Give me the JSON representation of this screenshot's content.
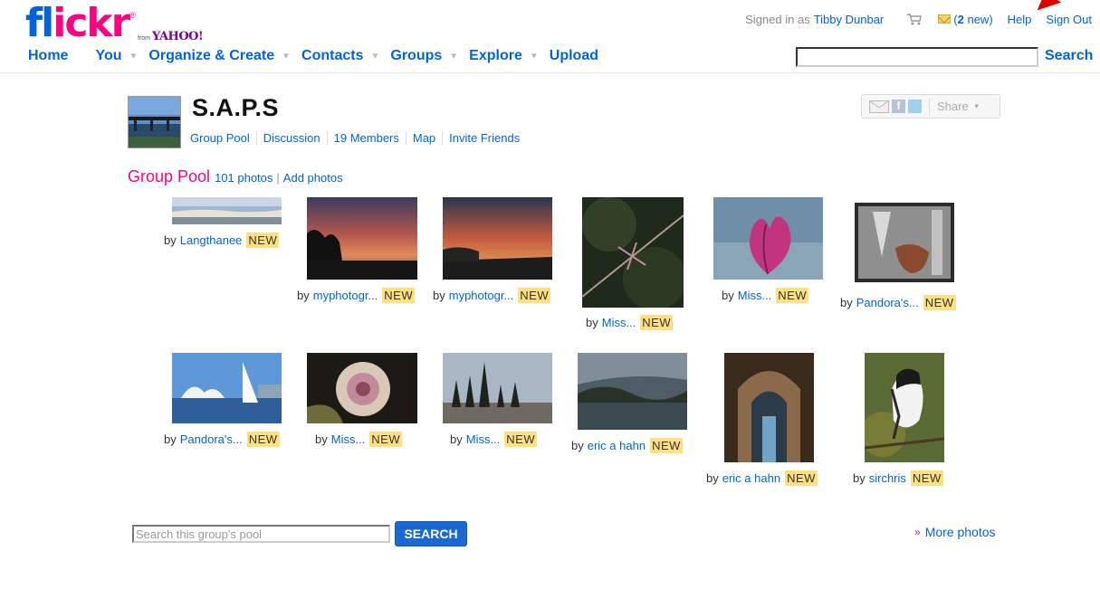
{
  "header": {
    "logo": {
      "flickr": "flickr",
      "from": "from",
      "yahoo": "YAHOO!",
      "registered": "®"
    },
    "signed_in_prefix": "Signed in as",
    "user_name": "Tibby Dunbar",
    "mail_new_count": "2",
    "mail_new_suffix": "new)",
    "mail_open_paren": "(",
    "help": "Help",
    "sign_out": "Sign Out",
    "nav": [
      "Home",
      "You",
      "Organize & Create",
      "Contacts",
      "Groups",
      "Explore",
      "Upload"
    ],
    "search_button": "Search",
    "search_value": ""
  },
  "group": {
    "title": "S.A.P.S",
    "links": [
      "Group Pool",
      "Discussion",
      "19 Members",
      "Map",
      "Invite Friends"
    ],
    "share_label": "Share"
  },
  "pool": {
    "title": "Group Pool",
    "photo_count": "101 photos",
    "separator": "|",
    "add_photos": "Add photos",
    "by_label": "by",
    "new_badge": "NEW",
    "photos": [
      {
        "author": "Langthanee"
      },
      {
        "author": "myphotogr..."
      },
      {
        "author": "myphotogr..."
      },
      {
        "author": "Miss..."
      },
      {
        "author": "Miss..."
      },
      {
        "author": "Pandora's..."
      },
      {
        "author": "Pandora's..."
      },
      {
        "author": "Miss..."
      },
      {
        "author": "Miss..."
      },
      {
        "author": "eric a hahn"
      },
      {
        "author": "eric a hahn"
      },
      {
        "author": "sirchris"
      }
    ],
    "search_placeholder": "Search this group's pool",
    "search_button": "SEARCH",
    "more_arrows": "»",
    "more_photos": "More photos"
  },
  "colors": {
    "link_blue": "#0063dc",
    "flickr_pink": "#ff0084",
    "new_badge_bg": "#ffdf80",
    "search_button_bg": "#1b68d3"
  }
}
